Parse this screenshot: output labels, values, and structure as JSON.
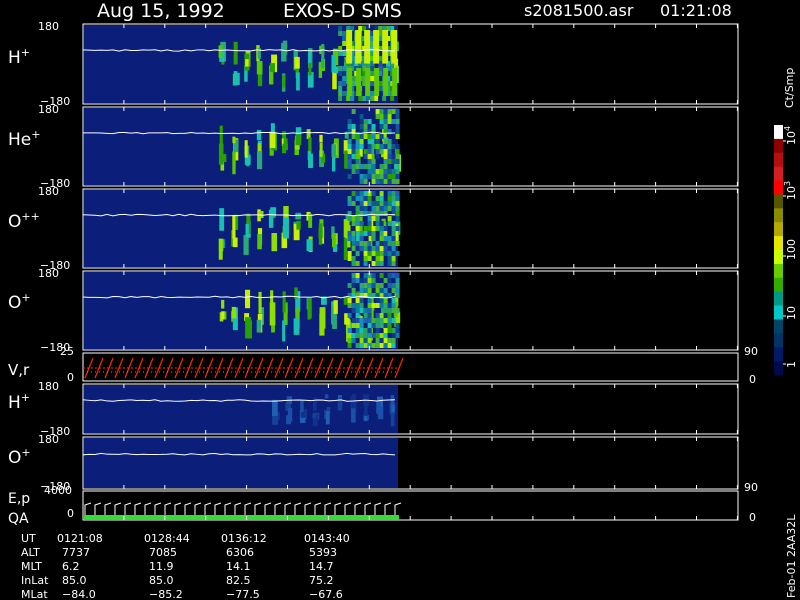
{
  "header": {
    "date": "Aug 15, 1992",
    "instrument": "EXOS-D SMS",
    "file": "s2081500.asr",
    "time": "01:21:08"
  },
  "colorbar": {
    "unit_label": "Ct/Smp",
    "tick_labels": [
      "10^4",
      "10^3",
      "100",
      "10",
      "1"
    ],
    "colors": [
      "#ffffff",
      "#8b0000",
      "#b01010",
      "#d21e1e",
      "#ff0000",
      "#555500",
      "#8b8b00",
      "#b5a800",
      "#e6e600",
      "#ccff00",
      "#66cc00",
      "#33aa00",
      "#009988",
      "#00c8c8",
      "#004466",
      "#003366",
      "#001a66",
      "#000a4a"
    ]
  },
  "panels": [
    {
      "id": "h-plus",
      "species": "H",
      "charge": "+",
      "top_label": "180",
      "bottom_label": "−180"
    },
    {
      "id": "he-plus",
      "species": "He",
      "charge": "+",
      "top_label": "180",
      "bottom_label": "−180"
    },
    {
      "id": "o-pp",
      "species": "O",
      "charge": "++",
      "top_label": "180",
      "bottom_label": "−180"
    },
    {
      "id": "o-plus",
      "species": "O",
      "charge": "+",
      "top_label": "180",
      "bottom_label": "−180"
    },
    {
      "id": "h-plus-2",
      "species": "H",
      "charge": "+",
      "top_label": "180",
      "bottom_label": "−180"
    },
    {
      "id": "o-plus-2",
      "species": "O",
      "charge": "+",
      "top_label": "180",
      "bottom_label": "−180"
    }
  ],
  "vr_panel": {
    "label": "V,r",
    "left_top": "25",
    "left_bottom": "0",
    "right_top": "90",
    "right_bottom": "0"
  },
  "ep_panel": {
    "label_top": "E,p",
    "label_bottom": "QA",
    "left_top": "4000",
    "left_bottom": "0",
    "right_top": "90",
    "right_bottom": "0"
  },
  "footer": {
    "row_labels": [
      "UT",
      "ALT",
      "MLT",
      "InLat",
      "MLat"
    ],
    "columns": [
      [
        "0121:08",
        "7737",
        "6.2",
        "85.0",
        "−84.0"
      ],
      [
        "0128:44",
        "7085",
        "11.9",
        "85.0",
        "−85.2"
      ],
      [
        "0136:12",
        "6306",
        "14.1",
        "82.5",
        "−77.5"
      ],
      [
        "0143:40",
        "5393",
        "14.7",
        "75.2",
        "−67.6"
      ]
    ],
    "side_note": "Feb-01 2AA32L"
  },
  "chart_data": {
    "type": "heatmap",
    "title": "Aug 15, 1992 EXOS-D SMS",
    "x_tick_labels": [
      "0121:08",
      "0128:44",
      "0136:12",
      "0143:40"
    ],
    "panels": [
      {
        "name": "H+",
        "ylim": [
          -180,
          180
        ],
        "bursts": [
          {
            "start": 0.43,
            "end": 1.0,
            "level": 2
          }
        ],
        "intense": {
          "start": 0.81,
          "end": 0.98,
          "level": 3
        }
      },
      {
        "name": "He+",
        "ylim": [
          -180,
          180
        ],
        "bursts": [
          {
            "start": 0.43,
            "end": 1.0,
            "level": 2
          }
        ],
        "intense": {
          "start": 0.84,
          "end": 1.0,
          "level": 2
        }
      },
      {
        "name": "O++",
        "ylim": [
          -180,
          180
        ],
        "bursts": [
          {
            "start": 0.43,
            "end": 1.0,
            "level": 2
          }
        ],
        "intense": {
          "start": 0.84,
          "end": 1.0,
          "level": 2
        }
      },
      {
        "name": "O+",
        "ylim": [
          -180,
          180
        ],
        "bursts": [
          {
            "start": 0.43,
            "end": 1.0,
            "level": 2
          }
        ],
        "intense": {
          "start": 0.84,
          "end": 1.0,
          "level": 2
        }
      },
      {
        "name": "H+",
        "ylim": [
          -180,
          180
        ],
        "bursts": [
          {
            "start": 0.6,
            "end": 1.0,
            "level": 1
          }
        ],
        "intense": null
      },
      {
        "name": "O+",
        "ylim": [
          -180,
          180
        ],
        "bursts": [],
        "intense": null
      }
    ],
    "vr": {
      "ylim": [
        0,
        25
      ],
      "y2lim": [
        0,
        90
      ]
    },
    "ep": {
      "ylim": [
        0,
        4000
      ],
      "y2lim": [
        0,
        90
      ]
    }
  }
}
